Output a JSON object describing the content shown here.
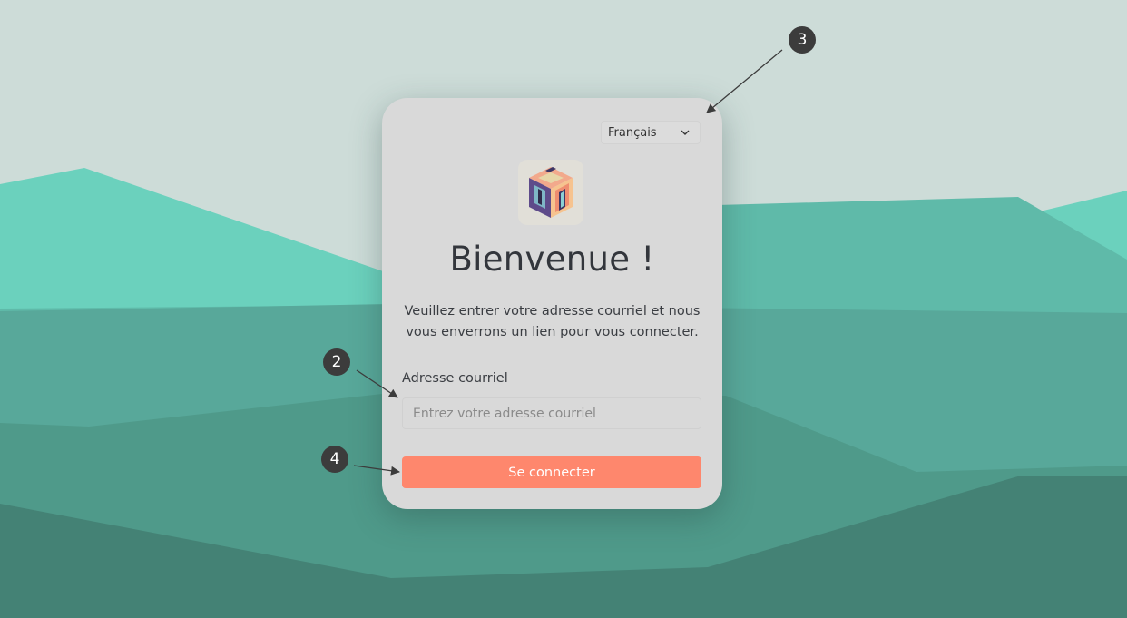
{
  "language_selector": {
    "selected": "Français",
    "icon": "chevron-down-icon"
  },
  "logo": {
    "icon": "cube-logo-icon"
  },
  "heading": "Bienvenue !",
  "description": "Veuillez entrer votre adresse courriel et nous vous enverrons un lien pour vous connecter.",
  "email_field": {
    "label": "Adresse courriel",
    "placeholder": "Entrez votre adresse courriel",
    "value": ""
  },
  "submit_button": {
    "label": "Se connecter"
  },
  "annotations": {
    "badge_1": "3",
    "badge_2": "2",
    "badge_3": "4"
  },
  "colors": {
    "sky": "#cddcd8",
    "mountain_light": "#6bd1bd",
    "mountain_mid": "#5fbaa9",
    "mountain_dark": "#4a9282",
    "card": "#d9d9d9",
    "button": "#fe876d",
    "badge": "#3c3c3c"
  }
}
